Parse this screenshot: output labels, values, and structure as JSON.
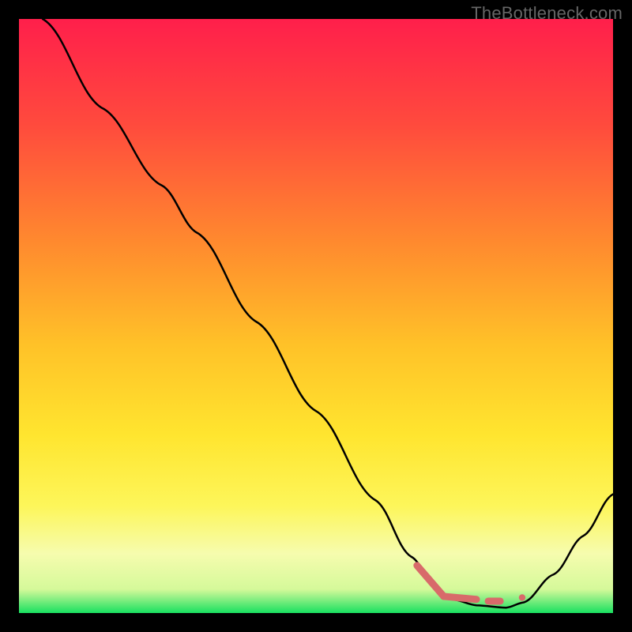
{
  "watermark": "TheBottleneck.com",
  "chart_data": {
    "type": "line",
    "title": "",
    "xlabel": "",
    "ylabel": "",
    "xlim": [
      0,
      100
    ],
    "ylim": [
      0,
      100
    ],
    "gradient_stops": [
      {
        "offset": 0,
        "color": "#ff1f4b"
      },
      {
        "offset": 18,
        "color": "#ff4b3d"
      },
      {
        "offset": 38,
        "color": "#ff8b2e"
      },
      {
        "offset": 55,
        "color": "#ffc228"
      },
      {
        "offset": 70,
        "color": "#ffe52f"
      },
      {
        "offset": 82,
        "color": "#fdf65a"
      },
      {
        "offset": 90,
        "color": "#f6fcae"
      },
      {
        "offset": 96,
        "color": "#d5f99a"
      },
      {
        "offset": 100,
        "color": "#18e060"
      }
    ],
    "series": [
      {
        "name": "bottleneck-curve",
        "stroke": "#000000",
        "stroke_width": 2.5,
        "points": [
          {
            "x": 4.0,
            "y": 100.0
          },
          {
            "x": 14.0,
            "y": 85.0
          },
          {
            "x": 24.0,
            "y": 72.0
          },
          {
            "x": 30.0,
            "y": 64.0
          },
          {
            "x": 40.0,
            "y": 49.0
          },
          {
            "x": 50.0,
            "y": 34.0
          },
          {
            "x": 60.0,
            "y": 19.0
          },
          {
            "x": 66.0,
            "y": 9.5
          },
          {
            "x": 70.0,
            "y": 4.5
          },
          {
            "x": 73.0,
            "y": 2.3
          },
          {
            "x": 77.0,
            "y": 1.3
          },
          {
            "x": 82.0,
            "y": 0.9
          },
          {
            "x": 85.0,
            "y": 1.8
          },
          {
            "x": 90.0,
            "y": 6.5
          },
          {
            "x": 95.0,
            "y": 13.0
          },
          {
            "x": 100.0,
            "y": 20.0
          }
        ]
      },
      {
        "name": "highlight-markers",
        "stroke": "#d86a6a",
        "stroke_width": 9,
        "segments": [
          {
            "x1": 67.0,
            "y1": 8.0,
            "x2": 71.5,
            "y2": 2.8
          },
          {
            "x1": 71.5,
            "y1": 2.8,
            "x2": 77.0,
            "y2": 2.3
          },
          {
            "x1": 79.0,
            "y1": 2.0,
            "x2": 81.0,
            "y2": 2.0
          }
        ],
        "dots": [
          {
            "x": 84.7,
            "y": 2.6,
            "r": 4.2
          }
        ]
      }
    ]
  }
}
